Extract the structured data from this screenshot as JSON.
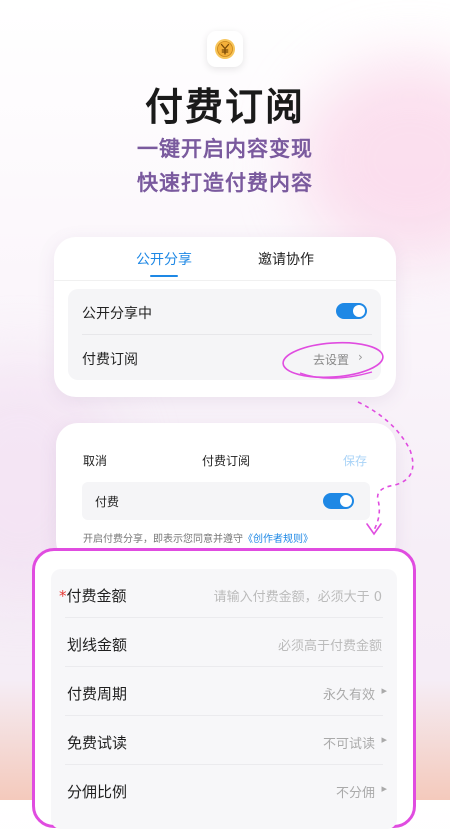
{
  "hero": {
    "title": "付费订阅",
    "subtitle_line1": "一键开启内容变现",
    "subtitle_line2": "快速打造付费内容",
    "logo_icon": "yen-coin-icon"
  },
  "share_card": {
    "tabs": [
      {
        "label": "公开分享",
        "active": true
      },
      {
        "label": "邀请协作",
        "active": false
      }
    ],
    "public_share_label": "公开分享中",
    "public_share_on": true,
    "paid_sub_label": "付费订阅",
    "paid_sub_action": "去设置"
  },
  "paid_card": {
    "cancel": "取消",
    "title": "付费订阅",
    "save": "保存",
    "fee_label": "付费",
    "fee_on": true,
    "note_prefix": "开启付费分享，即表示您同意并遵守",
    "note_link": "《创作者规则》"
  },
  "settings": {
    "rows": [
      {
        "required": "*",
        "label": "付费金额",
        "value": "请输入付费金额，必须大于 0",
        "chevron": false
      },
      {
        "required": "",
        "label": "划线金额",
        "value": "必须高于付费金额",
        "chevron": false
      },
      {
        "required": "",
        "label": "付费周期",
        "value": "永久有效",
        "chevron": true
      },
      {
        "required": "",
        "label": "免费试读",
        "value": "不可试读",
        "chevron": true
      },
      {
        "required": "",
        "label": "分佣比例",
        "value": "不分佣",
        "chevron": true
      }
    ]
  },
  "colors": {
    "accent": "#1e88e5",
    "highlight": "#e04ce0",
    "subtitle": "#7a5a9e"
  }
}
